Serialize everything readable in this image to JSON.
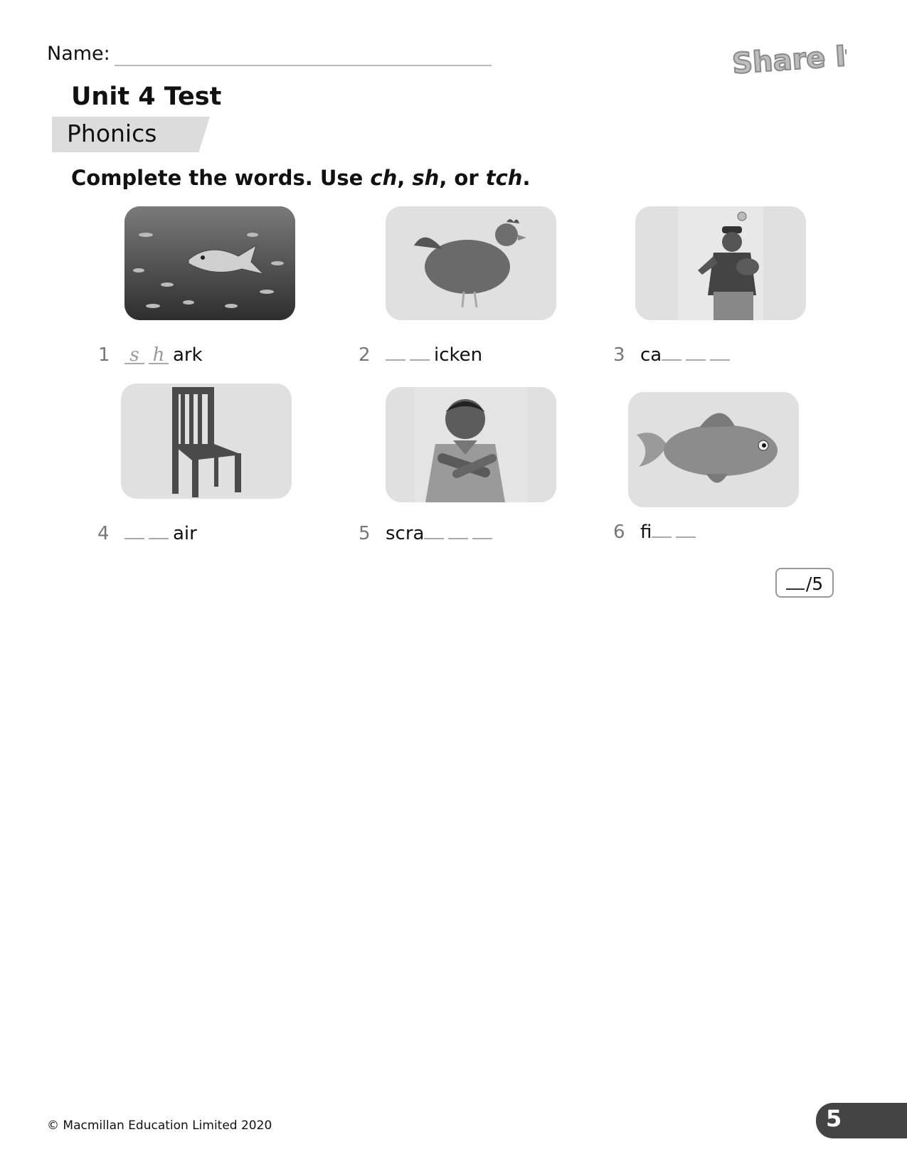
{
  "header": {
    "name_label": "Name:",
    "logo_text": "Share It!",
    "title": "Unit 4 Test",
    "section": "Phonics"
  },
  "instruction": {
    "prefix": "Complete the words. Use ",
    "opt1": "ch",
    "sep1": ", ",
    "opt2": "sh",
    "sep2": ", or ",
    "opt3": "tch",
    "suffix": "."
  },
  "items": [
    {
      "number": "1",
      "picture": "shark-icon",
      "before": "",
      "after": "ark",
      "answers": [
        "s",
        "h"
      ]
    },
    {
      "number": "2",
      "picture": "chicken-icon",
      "before": "",
      "after": "icken",
      "answers": [
        "",
        ""
      ]
    },
    {
      "number": "3",
      "picture": "baseball-boy-icon",
      "before": "ca",
      "after": "",
      "answers": [
        "",
        "",
        ""
      ]
    },
    {
      "number": "4",
      "picture": "chair-icon",
      "before": "",
      "after": "air",
      "answers": [
        "",
        ""
      ]
    },
    {
      "number": "5",
      "picture": "scratching-boy-icon",
      "before": "scra",
      "after": "",
      "answers": [
        "",
        "",
        ""
      ]
    },
    {
      "number": "6",
      "picture": "goldfish-icon",
      "before": "fi",
      "after": "",
      "answers": [
        "",
        ""
      ]
    }
  ],
  "score": {
    "total": "/5"
  },
  "footer": {
    "copyright": "© Macmillan Education Limited 2020",
    "page_number": "5"
  }
}
